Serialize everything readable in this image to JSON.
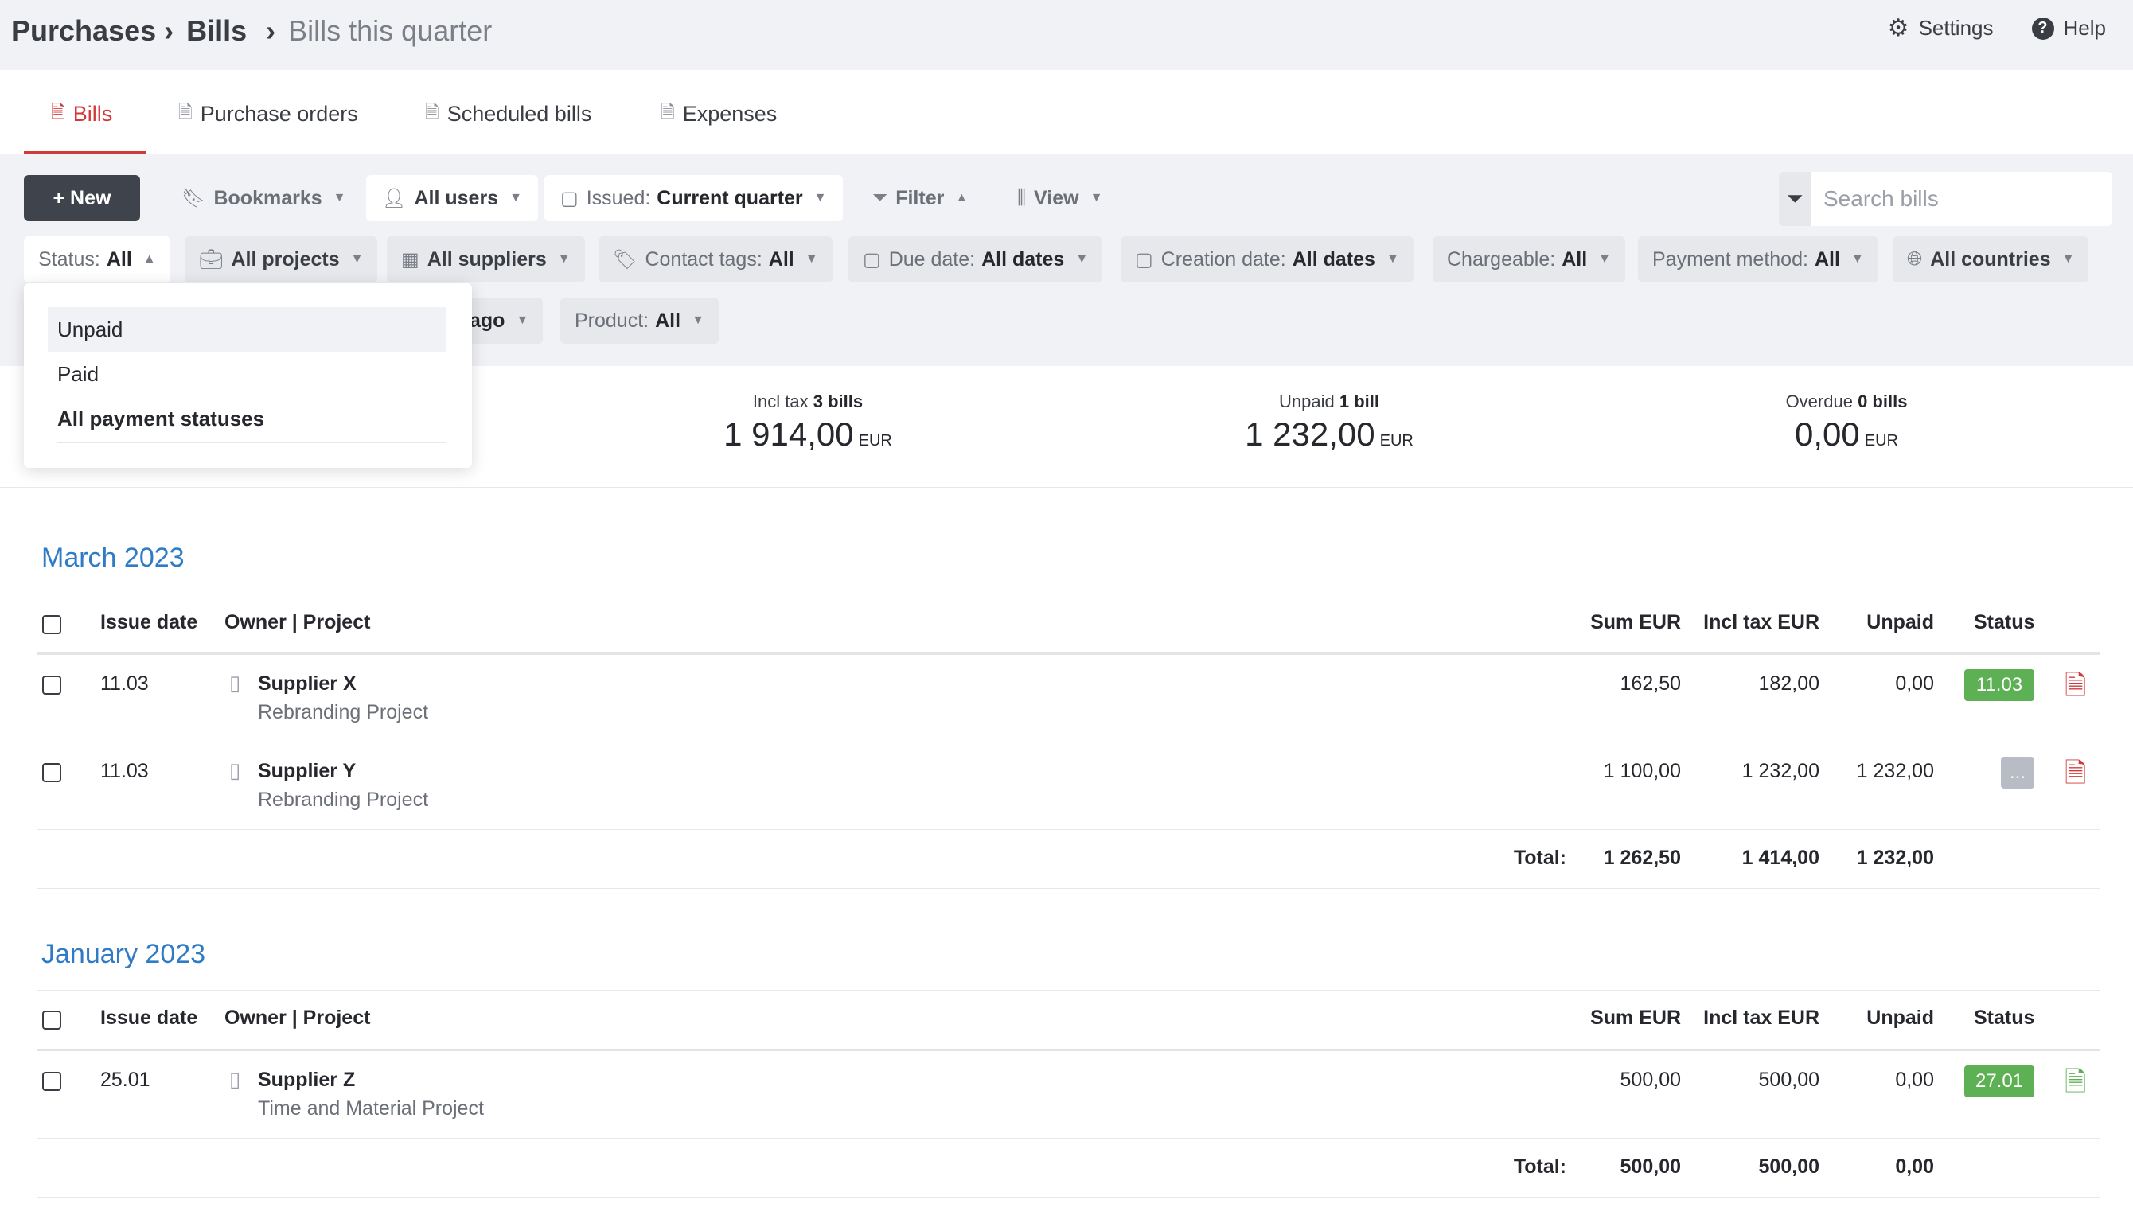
{
  "breadcrumb": {
    "root": "Purchases",
    "section": "Bills",
    "current": "Bills this quarter"
  },
  "top_actions": {
    "settings": "Settings",
    "help": "Help"
  },
  "tabs": [
    {
      "label": "Bills",
      "active": true
    },
    {
      "label": "Purchase orders"
    },
    {
      "label": "Scheduled bills"
    },
    {
      "label": "Expenses"
    }
  ],
  "toolbar": {
    "new_label": "+ New",
    "bookmarks": "Bookmarks",
    "users": "All users",
    "issued_label": "Issued:",
    "issued_value": "Current quarter",
    "filter": "Filter",
    "view": "View",
    "search_placeholder": "Search bills"
  },
  "filters": {
    "status_label": "Status:",
    "status_value": "All",
    "projects": "All projects",
    "suppliers": "All suppliers",
    "contact_tags_label": "Contact tags:",
    "contact_tags_value": "All",
    "due_date_label": "Due date:",
    "due_date_value": "All dates",
    "creation_date_label": "Creation date:",
    "creation_date_value": "All dates",
    "chargeable_label": "Chargeable:",
    "chargeable_value": "All",
    "payment_method_label": "Payment method:",
    "payment_method_value": "All",
    "countries": "All countries",
    "hidden_partial": "ago",
    "product_label": "Product:",
    "product_value": "All"
  },
  "status_dropdown": {
    "options": [
      "Unpaid",
      "Paid",
      "All payment statuses"
    ],
    "selected": "All payment statuses"
  },
  "summary": {
    "incl_tax": {
      "label": "Incl tax",
      "count": "3 bills",
      "value": "1 914,00",
      "currency": "EUR"
    },
    "unpaid": {
      "label": "Unpaid",
      "count": "1 bill",
      "value": "1 232,00",
      "currency": "EUR"
    },
    "overdue": {
      "label": "Overdue",
      "count": "0 bills",
      "value": "0,00",
      "currency": "EUR"
    }
  },
  "columns": {
    "issue_date": "Issue date",
    "owner_project": "Owner | Project",
    "sum": "Sum EUR",
    "incl_tax": "Incl tax EUR",
    "unpaid": "Unpaid",
    "status": "Status",
    "total": "Total:"
  },
  "groups": [
    {
      "title": "March 2023",
      "rows": [
        {
          "date": "11.03",
          "supplier": "Supplier X",
          "project": "Rebranding Project",
          "sum": "162,50",
          "incl_tax": "182,00",
          "unpaid": "0,00",
          "status": "11.03",
          "status_color": "#5db054",
          "doc_color": "#d23a3a"
        },
        {
          "date": "11.03",
          "supplier": "Supplier Y",
          "project": "Rebranding Project",
          "sum": "1 100,00",
          "incl_tax": "1 232,00",
          "unpaid": "1 232,00",
          "status": "...",
          "status_color": "#b8bcc4",
          "doc_color": "#d23a3a"
        }
      ],
      "total": {
        "sum": "1 262,50",
        "incl_tax": "1 414,00",
        "unpaid": "1 232,00"
      }
    },
    {
      "title": "January 2023",
      "rows": [
        {
          "date": "25.01",
          "supplier": "Supplier Z",
          "project": "Time and Material Project",
          "sum": "500,00",
          "incl_tax": "500,00",
          "unpaid": "0,00",
          "status": "27.01",
          "status_color": "#5db054",
          "doc_color": "#5db054"
        }
      ],
      "total": {
        "sum": "500,00",
        "incl_tax": "500,00",
        "unpaid": "0,00"
      }
    }
  ]
}
